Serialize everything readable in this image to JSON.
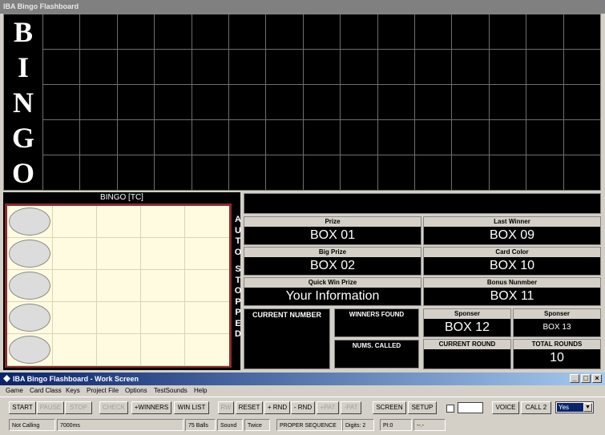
{
  "flashboard": {
    "title": "IBA Bingo Flashboard",
    "letters": [
      "B",
      "I",
      "N",
      "G",
      "O"
    ]
  },
  "card": {
    "title": "BINGO [TC]",
    "auto_status": [
      "A",
      "U",
      "T",
      "O",
      "",
      "S",
      "T",
      "O",
      "P",
      "P",
      "E",
      "D"
    ]
  },
  "info": {
    "prize": {
      "label": "Prize",
      "value": "BOX 01"
    },
    "last_winner": {
      "label": "Last Winner",
      "value": "BOX 09"
    },
    "big_prize": {
      "label": "Big Prize",
      "value": "BOX 02"
    },
    "card_color": {
      "label": "Card Color",
      "value": "BOX 10"
    },
    "quick_win": {
      "label": "Quick Win Prize",
      "value": "Your Information"
    },
    "bonus_number": {
      "label": "Bonus Nunmber",
      "value": "BOX 11"
    },
    "current_number": {
      "label": "CURRENT NUMBER",
      "value": ""
    },
    "winners_found": {
      "label": "WINNERS FOUND",
      "value": ""
    },
    "nums_called": {
      "label": "NUMS. CALLED",
      "value": ""
    },
    "sponser1": {
      "label": "Sponser",
      "value": "BOX 12"
    },
    "sponser2": {
      "label": "Sponser",
      "value": "BOX 13"
    },
    "current_round": {
      "label": "CURRENT ROUND",
      "value": ""
    },
    "total_rounds": {
      "label": "TOTAL ROUNDS",
      "value": "10"
    }
  },
  "workscreen": {
    "title": "IBA Bingo Flashboard - Work Screen",
    "window_buttons": [
      "_",
      "□",
      "×"
    ],
    "menu": [
      "Game",
      "Card Class",
      "Keys",
      "Project File",
      "Options",
      "TestSounds",
      "Help"
    ],
    "toolbar": {
      "start": "START",
      "pause": "PAUSE",
      "stop": "STOP",
      "check": "CHECK",
      "winners": "+WINNERS",
      "winlist": "WIN LIST",
      "rw": "RW",
      "reset": "RESET",
      "plus_rnd": "+ RND",
      "minus_rnd": "- RND",
      "plus_pat": "+PAT",
      "minus_pat": "-PAT",
      "screen": "SCREEN",
      "setup": "SETUP",
      "voice": "VOICE",
      "call": "CALL 2",
      "select_value": "Yes"
    },
    "status": {
      "calling": "Not Calling",
      "speed": "7000ms",
      "balls": "75 Balls",
      "sound": "Sound",
      "twice": "Twice",
      "sequence": "PROPER SEQUENCE",
      "digits": "Digits:  2",
      "pi": "PI:0",
      "dash": "--.-"
    }
  }
}
